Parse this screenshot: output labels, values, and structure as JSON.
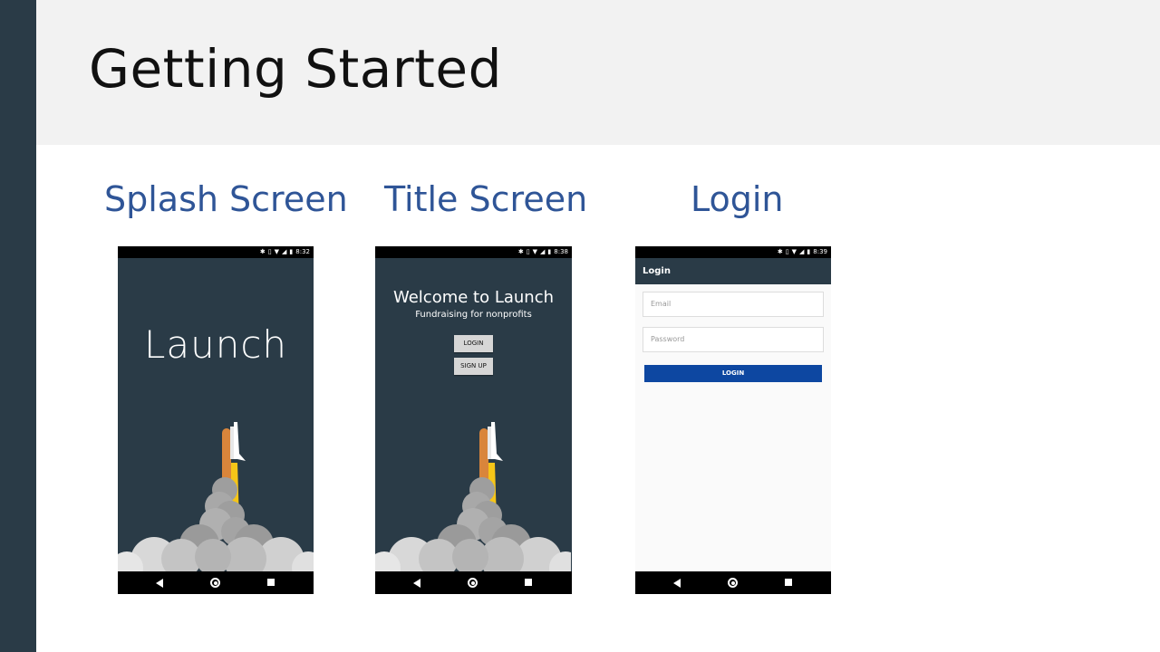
{
  "slide": {
    "title": "Getting Started",
    "colors": {
      "sidebar": "#2a3b47",
      "header_band": "#f2f2f2",
      "caption": "#2f5597"
    }
  },
  "panels": [
    {
      "caption": "Splash Screen",
      "status_time": "8:32",
      "app_name": "Launch"
    },
    {
      "caption": "Title Screen",
      "status_time": "8:38",
      "welcome_title": "Welcome to Launch",
      "welcome_subtitle": "Fundraising for nonprofits",
      "login_label": "LOGIN",
      "signup_label": "SIGN UP"
    },
    {
      "caption": "Login",
      "status_time": "8:39",
      "app_bar_title": "Login",
      "email_placeholder": "Email",
      "password_placeholder": "Password",
      "login_label": "LOGIN",
      "login_button_color": "#0d47a1"
    }
  ]
}
